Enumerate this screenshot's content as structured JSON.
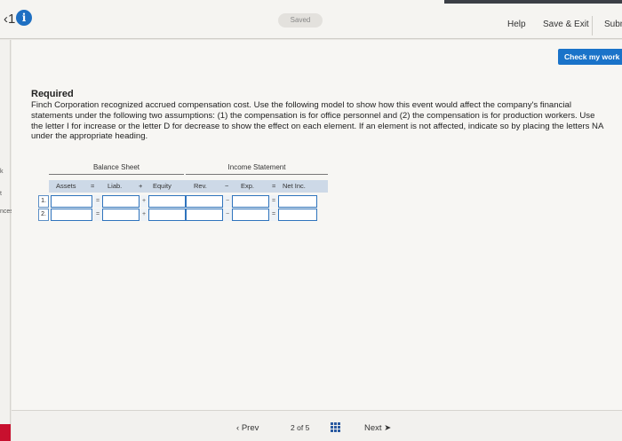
{
  "topbar": {
    "question_number": "1",
    "saved_label": "Saved",
    "help_label": "Help",
    "save_exit_label": "Save & Exit",
    "submit_label": "Subm"
  },
  "check_button_label": "Check my work",
  "question": {
    "heading": "Required",
    "text": "Finch Corporation recognized accrued compensation cost. Use the following model to show how this event would affect the company's financial statements under the following two assumptions: (1) the compensation is for office personnel and (2) the compensation is for production workers. Use the letter I for increase or the letter D for decrease to show the effect on each element. If an element is not affected, indicate so by placing the letters NA under the appropriate heading."
  },
  "model": {
    "balance_sheet_label": "Balance Sheet",
    "income_statement_label": "Income Statement",
    "columns": [
      "Assets",
      "=",
      "Liab.",
      "+",
      "Equity",
      "Rev.",
      "−",
      "Exp.",
      "=",
      "Net Inc."
    ],
    "rows": [
      {
        "number": "1.",
        "assets": "",
        "liab": "",
        "equity": "",
        "rev": "",
        "exp": "",
        "net_inc": ""
      },
      {
        "number": "2.",
        "assets": "",
        "liab": "",
        "equity": "",
        "rev": "",
        "exp": "",
        "net_inc": ""
      }
    ],
    "operators": {
      "eq": "=",
      "plus": "+",
      "minus": "−"
    }
  },
  "left_strip": {
    "labels": [
      "k",
      "t",
      "nces"
    ]
  },
  "nav": {
    "prev_label": "Prev",
    "page_current": "2",
    "page_of": "of",
    "page_total": "5",
    "next_label": "Next"
  },
  "colors": {
    "accent": "#1a73c9",
    "header_fill": "#cdd9e7"
  }
}
